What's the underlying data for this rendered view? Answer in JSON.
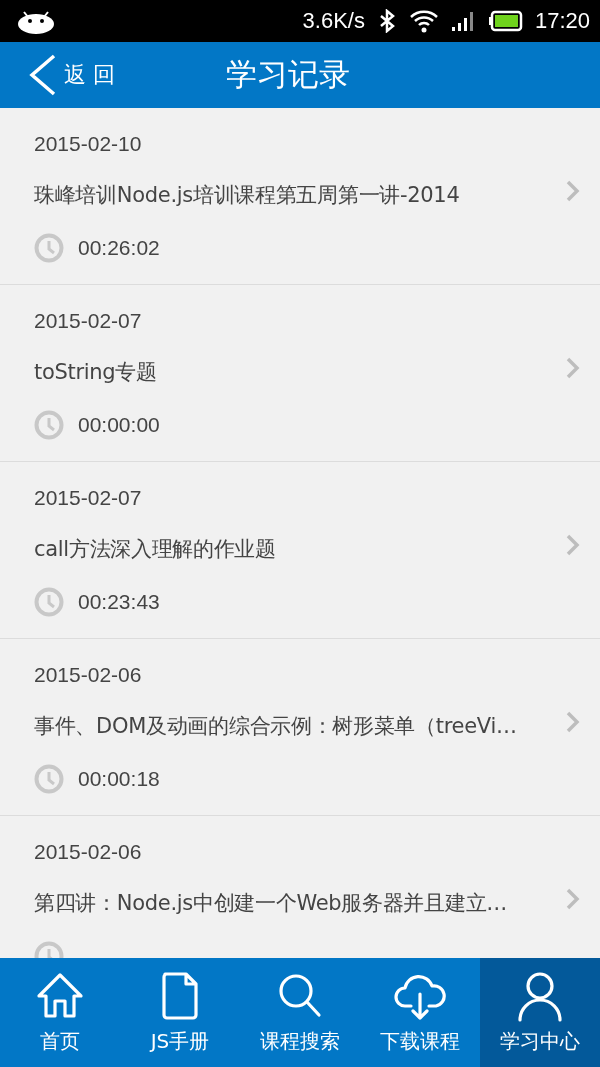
{
  "status_bar": {
    "speed": "3.6K/s",
    "time": "17:20"
  },
  "header": {
    "back": "返 回",
    "title": "学习记录"
  },
  "records": [
    {
      "date": "2015-02-10",
      "title": "珠峰培训Node.js培训课程第五周第一讲-2014",
      "duration": "00:26:02"
    },
    {
      "date": "2015-02-07",
      "title": "toString专题",
      "duration": "00:00:00"
    },
    {
      "date": "2015-02-07",
      "title": "call方法深入理解的作业题",
      "duration": "00:23:43"
    },
    {
      "date": "2015-02-06",
      "title": "事件、DOM及动画的综合示例：树形菜单（treeVi…",
      "duration": "00:00:18"
    },
    {
      "date": "2015-02-06",
      "title": "第四讲：Node.js中创建一个Web服务器并且建立…"
    }
  ],
  "tab_bar": [
    {
      "kind": "home",
      "label": "首页",
      "selected": false
    },
    {
      "kind": "document",
      "label": "JS手册",
      "selected": false
    },
    {
      "kind": "search",
      "label": "课程搜索",
      "selected": false
    },
    {
      "kind": "download",
      "label": "下载课程",
      "selected": false
    },
    {
      "kind": "user",
      "label": "学习中心",
      "selected": true
    }
  ]
}
